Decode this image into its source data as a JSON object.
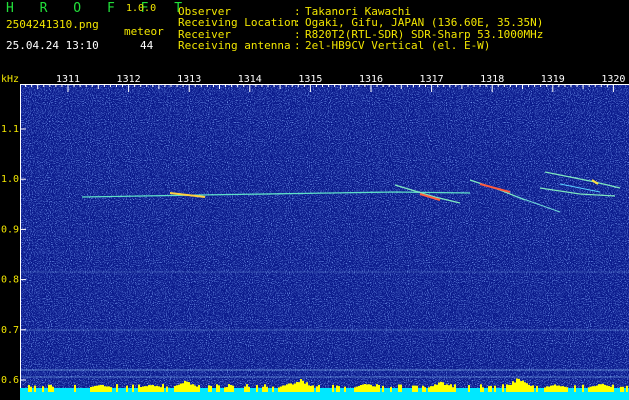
{
  "app": {
    "name": "H R O F F T",
    "version": "1.0.0"
  },
  "file": {
    "name": "2504241310.png",
    "datetime": "25.04.24 13:10"
  },
  "meteor": {
    "label": "meteor",
    "count": "44"
  },
  "info": [
    {
      "key": "Observer",
      "sep": ":",
      "value": "Takanori Kawachi"
    },
    {
      "key": "Receiving Location",
      "sep": ":",
      "value": "Ogaki, Gifu, JAPAN (136.60E, 35.35N)"
    },
    {
      "key": "Receiver",
      "sep": ":",
      "value": "R820T2(RTL-SDR) SDR-Sharp 53.1000MHz"
    },
    {
      "key": "Receiving antenna",
      "sep": ":",
      "value": "2el-HB9CV Vertical (el. E-W)"
    }
  ],
  "plot": {
    "y_unit": "kHz",
    "y_ticks": [
      "1.1",
      "1.0",
      "0.9",
      "0.8",
      "0.7",
      "0.6"
    ],
    "x_ticks": [
      "1311",
      "1312",
      "1313",
      "1314",
      "1315",
      "1316",
      "1317",
      "1318",
      "1319",
      "1320"
    ],
    "colors": {
      "background": "#0a1a8c",
      "noise": "#3a64ff",
      "baseline": "#00e8ff",
      "peaks": "#ffff00"
    }
  }
}
